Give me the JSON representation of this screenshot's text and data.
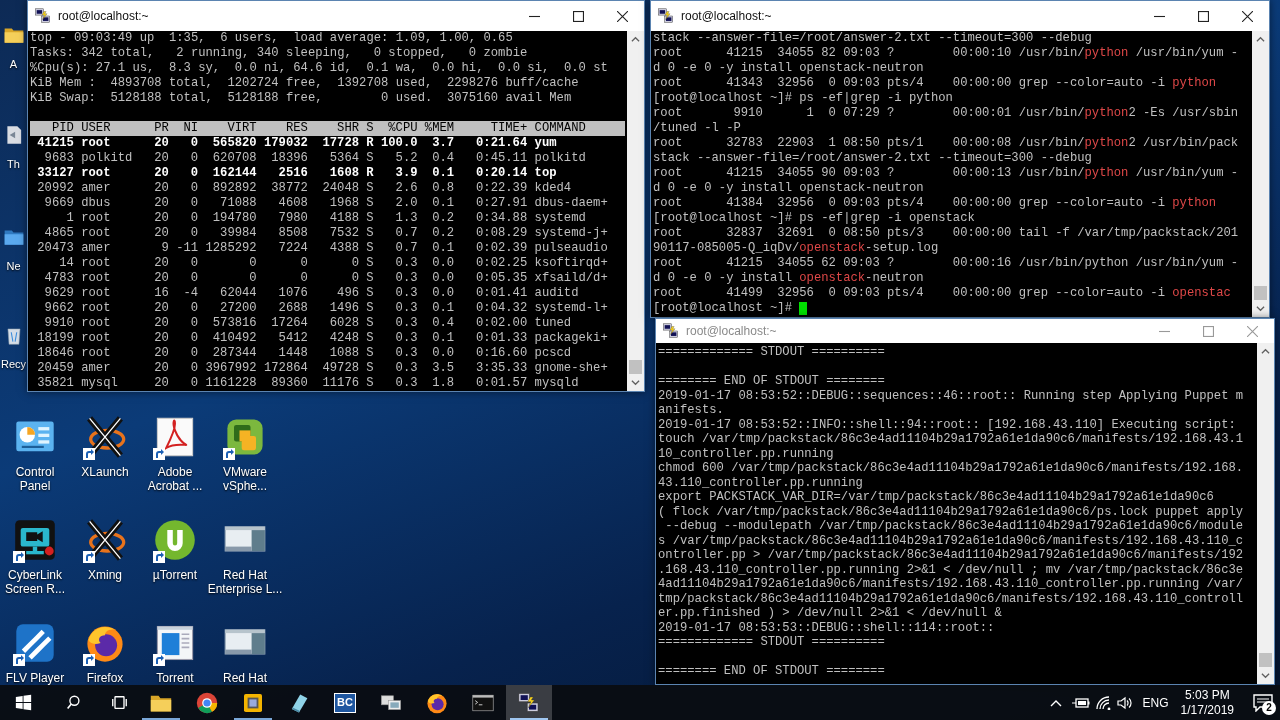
{
  "top_window": {
    "title": "root@localhost:~",
    "active": true,
    "summary": [
      "top - 09:03:49 up  1:35,  6 users,  load average: 1.09, 1.00, 0.65",
      "Tasks: 342 total,   2 running, 340 sleeping,   0 stopped,   0 zombie",
      "%Cpu(s): 27.1 us,  8.3 sy,  0.0 ni, 64.6 id,  0.1 wa,  0.0 hi,  0.0 si,  0.0 st",
      "KiB Mem :  4893708 total,  1202724 free,  1392708 used,  2298276 buff/cache",
      "KiB Swap:  5128188 total,  5128188 free,        0 used.  3075160 avail Mem"
    ],
    "columns": [
      "PID",
      "USER",
      "PR",
      "NI",
      "VIRT",
      "RES",
      "SHR",
      "S",
      "%CPU",
      "%MEM",
      "TIME+",
      "COMMAND"
    ],
    "rows": [
      {
        "cells": [
          "41215",
          "root",
          "20",
          "0",
          "565820",
          "179032",
          "17728",
          "R",
          "100.0",
          "3.7",
          "0:21.64",
          "yum"
        ],
        "running": true
      },
      {
        "cells": [
          "9683",
          "polkitd",
          "20",
          "0",
          "620708",
          "18396",
          "5364",
          "S",
          "5.2",
          "0.4",
          "0:45.11",
          "polkitd"
        ],
        "running": false
      },
      {
        "cells": [
          "33127",
          "root",
          "20",
          "0",
          "162144",
          "2516",
          "1608",
          "R",
          "3.9",
          "0.1",
          "0:20.14",
          "top"
        ],
        "running": true
      },
      {
        "cells": [
          "20992",
          "amer",
          "20",
          "0",
          "892892",
          "38772",
          "24048",
          "S",
          "2.6",
          "0.8",
          "0:22.39",
          "kded4"
        ],
        "running": false
      },
      {
        "cells": [
          "9669",
          "dbus",
          "20",
          "0",
          "71088",
          "4608",
          "1968",
          "S",
          "2.0",
          "0.1",
          "0:27.91",
          "dbus-daem+"
        ],
        "running": false
      },
      {
        "cells": [
          "1",
          "root",
          "20",
          "0",
          "194780",
          "7980",
          "4188",
          "S",
          "1.3",
          "0.2",
          "0:34.88",
          "systemd"
        ],
        "running": false
      },
      {
        "cells": [
          "4865",
          "root",
          "20",
          "0",
          "39984",
          "8508",
          "7532",
          "S",
          "0.7",
          "0.2",
          "0:08.29",
          "systemd-j+"
        ],
        "running": false
      },
      {
        "cells": [
          "20473",
          "amer",
          "9",
          "-11",
          "1285292",
          "7224",
          "4388",
          "S",
          "0.7",
          "0.1",
          "0:02.39",
          "pulseaudio"
        ],
        "running": false
      },
      {
        "cells": [
          "14",
          "root",
          "20",
          "0",
          "0",
          "0",
          "0",
          "S",
          "0.3",
          "0.0",
          "0:02.25",
          "ksoftirqd+"
        ],
        "running": false
      },
      {
        "cells": [
          "4783",
          "root",
          "20",
          "0",
          "0",
          "0",
          "0",
          "S",
          "0.3",
          "0.0",
          "0:05.35",
          "xfsaild/d+"
        ],
        "running": false
      },
      {
        "cells": [
          "9629",
          "root",
          "16",
          "-4",
          "62044",
          "1076",
          "496",
          "S",
          "0.3",
          "0.0",
          "0:01.41",
          "auditd"
        ],
        "running": false
      },
      {
        "cells": [
          "9662",
          "root",
          "20",
          "0",
          "27200",
          "2688",
          "1496",
          "S",
          "0.3",
          "0.1",
          "0:04.32",
          "systemd-l+"
        ],
        "running": false
      },
      {
        "cells": [
          "9910",
          "root",
          "20",
          "0",
          "573816",
          "17264",
          "6028",
          "S",
          "0.3",
          "0.4",
          "0:02.00",
          "tuned"
        ],
        "running": false
      },
      {
        "cells": [
          "18199",
          "root",
          "20",
          "0",
          "410492",
          "5412",
          "4248",
          "S",
          "0.3",
          "0.1",
          "0:01.33",
          "packageki+"
        ],
        "running": false
      },
      {
        "cells": [
          "18646",
          "root",
          "20",
          "0",
          "287344",
          "1448",
          "1088",
          "S",
          "0.3",
          "0.0",
          "0:16.60",
          "pcscd"
        ],
        "running": false
      },
      {
        "cells": [
          "20459",
          "amer",
          "20",
          "0",
          "3967992",
          "172864",
          "49728",
          "S",
          "0.3",
          "3.5",
          "3:35.33",
          "gnome-she+"
        ],
        "running": false
      },
      {
        "cells": [
          "35821",
          "mysql",
          "20",
          "0",
          "1161228",
          "89360",
          "11176",
          "S",
          "0.3",
          "1.8",
          "0:01.57",
          "mysqld"
        ],
        "running": false
      }
    ]
  },
  "ps_window": {
    "title": "root@localhost:~",
    "active": true,
    "lines": [
      {
        "segments": [
          {
            "text": "stack --answer-file=/root/answer-2.txt --timeout=300 --debug",
            "match": false
          }
        ]
      },
      {
        "segments": [
          {
            "text": "root      41215  34055 82 09:03 ?        00:00:10 /usr/bin/",
            "match": false
          },
          {
            "text": "python",
            "match": true
          },
          {
            "text": " /usr/bin/yum -",
            "match": false
          }
        ]
      },
      {
        "segments": [
          {
            "text": "d 0 -e 0 -y install openstack-neutron",
            "match": false
          }
        ]
      },
      {
        "segments": [
          {
            "text": "root      41343  32956  0 09:03 pts/4    00:00:00 grep --color=auto -i ",
            "match": false
          },
          {
            "text": "python",
            "match": true
          }
        ]
      },
      {
        "segments": [
          {
            "text": "[root@localhost ~]# ps -ef|grep -i python",
            "match": false
          }
        ]
      },
      {
        "segments": [
          {
            "text": "root       9910      1  0 07:29 ?        00:00:01 /usr/bin/",
            "match": false
          },
          {
            "text": "python",
            "match": true
          },
          {
            "text": "2 -Es /usr/sbin",
            "match": false
          }
        ]
      },
      {
        "segments": [
          {
            "text": "/tuned -l -P",
            "match": false
          }
        ]
      },
      {
        "segments": [
          {
            "text": "root      32783  22903  1 08:50 pts/1    00:00:08 /usr/bin/",
            "match": false
          },
          {
            "text": "python",
            "match": true
          },
          {
            "text": "2 /usr/bin/pack",
            "match": false
          }
        ]
      },
      {
        "segments": [
          {
            "text": "stack --answer-file=/root/answer-2.txt --timeout=300 --debug",
            "match": false
          }
        ]
      },
      {
        "segments": [
          {
            "text": "root      41215  34055 90 09:03 ?        00:00:13 /usr/bin/",
            "match": false
          },
          {
            "text": "python",
            "match": true
          },
          {
            "text": " /usr/bin/yum -",
            "match": false
          }
        ]
      },
      {
        "segments": [
          {
            "text": "d 0 -e 0 -y install openstack-neutron",
            "match": false
          }
        ]
      },
      {
        "segments": [
          {
            "text": "root      41384  32956  0 09:03 pts/4    00:00:00 grep --color=auto -i ",
            "match": false
          },
          {
            "text": "python",
            "match": true
          }
        ]
      },
      {
        "segments": [
          {
            "text": "[root@localhost ~]# ps -ef|grep -i openstack",
            "match": false
          }
        ]
      },
      {
        "segments": [
          {
            "text": "root      32837  32691  0 08:50 pts/3    00:00:00 tail -f /var/tmp/packstack/201",
            "match": false
          }
        ]
      },
      {
        "segments": [
          {
            "text": "90117-085005-Q_iqDv/",
            "match": false
          },
          {
            "text": "openstack",
            "match": true
          },
          {
            "text": "-setup.log",
            "match": false
          }
        ]
      },
      {
        "segments": [
          {
            "text": "root      41215  34055 62 09:03 ?        00:00:16 /usr/bin/python /usr/bin/yum -",
            "match": false
          }
        ]
      },
      {
        "segments": [
          {
            "text": "d 0 -e 0 -y install ",
            "match": false
          },
          {
            "text": "openstack",
            "match": true
          },
          {
            "text": "-neutron",
            "match": false
          }
        ]
      },
      {
        "segments": [
          {
            "text": "root      41499  32956  0 09:03 pts/4    00:00:00 grep --color=auto -i ",
            "match": false
          },
          {
            "text": "openstac",
            "match": true
          }
        ]
      },
      {
        "segments": [
          {
            "text": "[root@localhost ~]#",
            "match": false
          }
        ],
        "cursor": true
      }
    ]
  },
  "log_window": {
    "title": "root@localhost:~",
    "active": false,
    "lines": [
      {
        "kind": "text",
        "text": "============= STDOUT =========="
      },
      {
        "kind": "blank"
      },
      {
        "kind": "text",
        "text": "======== END OF STDOUT ========"
      },
      {
        "kind": "text",
        "text": "2019-01-17 08:53:52::DEBUG::sequences::46::root:: Running step Applying Puppet m"
      },
      {
        "kind": "text",
        "text": "anifests."
      },
      {
        "kind": "text",
        "text": "2019-01-17 08:53:52::INFO::shell::94::root:: [192.168.43.110] Executing script:"
      },
      {
        "kind": "text",
        "text": "touch /var/tmp/packstack/86c3e4ad11104b29a1792a61e1da90c6/manifests/192.168.43.1"
      },
      {
        "kind": "text",
        "text": "10_controller.pp.running"
      },
      {
        "kind": "text",
        "text": "chmod 600 /var/tmp/packstack/86c3e4ad11104b29a1792a61e1da90c6/manifests/192.168."
      },
      {
        "kind": "text",
        "text": "43.110_controller.pp.running"
      },
      {
        "kind": "text",
        "text": "export PACKSTACK_VAR_DIR=/var/tmp/packstack/86c3e4ad11104b29a1792a61e1da90c6"
      },
      {
        "kind": "text",
        "text": "( flock /var/tmp/packstack/86c3e4ad11104b29a1792a61e1da90c6/ps.lock puppet apply"
      },
      {
        "kind": "text",
        "text": " --debug --modulepath /var/tmp/packstack/86c3e4ad11104b29a1792a61e1da90c6/module"
      },
      {
        "kind": "text",
        "text": "s /var/tmp/packstack/86c3e4ad11104b29a1792a61e1da90c6/manifests/192.168.43.110_c"
      },
      {
        "kind": "text",
        "text": "ontroller.pp > /var/tmp/packstack/86c3e4ad11104b29a1792a61e1da90c6/manifests/192"
      },
      {
        "kind": "text",
        "text": ".168.43.110_controller.pp.running 2>&1 < /dev/null ; mv /var/tmp/packstack/86c3e"
      },
      {
        "kind": "text",
        "text": "4ad11104b29a1792a61e1da90c6/manifests/192.168.43.110_controller.pp.running /var/"
      },
      {
        "kind": "text",
        "text": "tmp/packstack/86c3e4ad11104b29a1792a61e1da90c6/manifests/192.168.43.110_controll"
      },
      {
        "kind": "text",
        "text": "er.pp.finished ) > /dev/null 2>&1 < /dev/null &"
      },
      {
        "kind": "text",
        "text": "2019-01-17 08:53:53::DEBUG::shell::114::root::"
      },
      {
        "kind": "text",
        "text": "============= STDOUT =========="
      },
      {
        "kind": "blank"
      },
      {
        "kind": "text",
        "text": "======== END OF STDOUT ========"
      }
    ]
  },
  "edge_icons": [
    {
      "kind": "folder",
      "label": "A"
    },
    {
      "kind": "page",
      "label": "Th"
    },
    {
      "kind": "network",
      "label": "Ne"
    },
    {
      "kind": "bin",
      "label": "Recy"
    }
  ],
  "desktop_icons": [
    {
      "kind": "control-panel",
      "label": [
        "Control",
        "Panel"
      ],
      "shortcut": false
    },
    {
      "kind": "x-logo",
      "label": [
        "XLaunch"
      ],
      "shortcut": true
    },
    {
      "kind": "pdf",
      "label": [
        "Adobe",
        "Acrobat ..."
      ],
      "shortcut": true
    },
    {
      "kind": "squares",
      "label": [
        "VMware",
        "vSphe..."
      ],
      "shortcut": true
    },
    {
      "kind": "video-monitor",
      "label": [
        "CyberLink",
        "Screen R..."
      ],
      "shortcut": true
    },
    {
      "kind": "x-logo",
      "label": [
        "Xming"
      ],
      "shortcut": true
    },
    {
      "kind": "green-circle",
      "label": [
        "µTorrent"
      ],
      "shortcut": true
    },
    {
      "kind": "window-thumb",
      "label": [
        "Red Hat",
        "Enterprise L..."
      ],
      "shortcut": false
    },
    {
      "kind": "blue-tile",
      "label": [
        "FLV Player"
      ],
      "shortcut": true
    },
    {
      "kind": "orange-globe",
      "label": [
        "Firefox"
      ],
      "shortcut": true
    },
    {
      "kind": "blue-window",
      "label": [
        "Torrent"
      ],
      "shortcut": true
    },
    {
      "kind": "window-thumb",
      "label": [
        "Red Hat"
      ],
      "shortcut": false
    }
  ],
  "taskbar": {
    "apps": [
      {
        "kind": "folder",
        "running": true,
        "active": false
      },
      {
        "kind": "circle-logo",
        "running": false,
        "active": false
      },
      {
        "kind": "yellow-square",
        "running": true,
        "active": false
      },
      {
        "kind": "notebook",
        "running": false,
        "active": false
      },
      {
        "kind": "text",
        "label": "BC",
        "running": false,
        "active": false
      },
      {
        "kind": "computers",
        "running": false,
        "active": false
      },
      {
        "kind": "orange-globe",
        "running": false,
        "active": false
      },
      {
        "kind": "terminal",
        "running": false,
        "active": false
      },
      {
        "kind": "putty",
        "running": true,
        "active": true
      }
    ],
    "language": "ENG",
    "time": "5:03 PM",
    "date": "1/17/2019",
    "notifications": "2"
  }
}
